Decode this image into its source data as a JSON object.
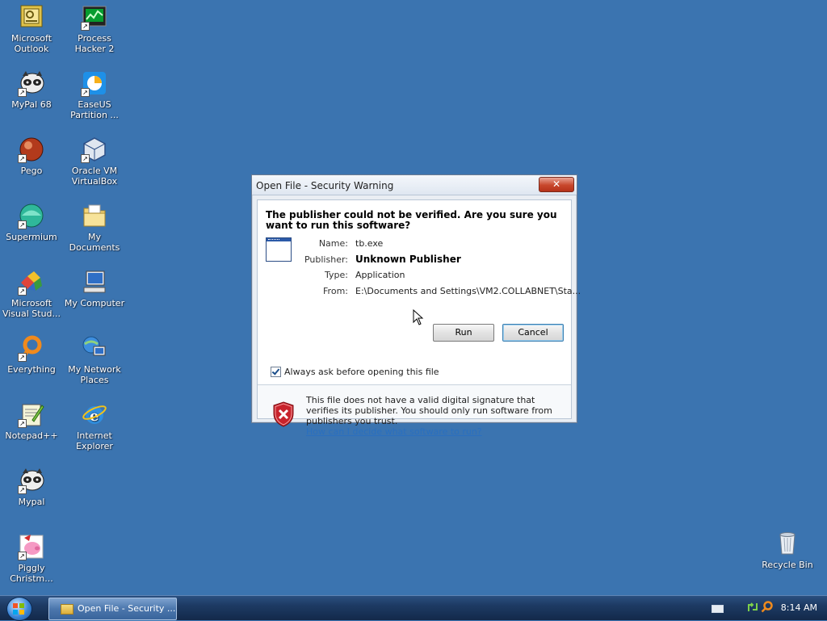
{
  "desktop": {
    "icons": [
      {
        "label": "Microsoft Outlook",
        "icon": "outlook-icon"
      },
      {
        "label": "Process Hacker 2",
        "icon": "process-hacker-icon"
      },
      {
        "label": "MyPal 68",
        "icon": "mypal-icon"
      },
      {
        "label": "EaseUS Partition ...",
        "icon": "easeus-icon"
      },
      {
        "label": "Pego",
        "icon": "pego-icon"
      },
      {
        "label": "Oracle VM VirtualBox",
        "icon": "virtualbox-icon"
      },
      {
        "label": "Supermium",
        "icon": "supermium-icon"
      },
      {
        "label": "My Documents",
        "icon": "folder-icon"
      },
      {
        "label": "Microsoft Visual Stud...",
        "icon": "visual-studio-icon"
      },
      {
        "label": "My Computer",
        "icon": "computer-icon"
      },
      {
        "label": "Everything",
        "icon": "everything-icon"
      },
      {
        "label": "My Network Places",
        "icon": "network-icon"
      },
      {
        "label": "Notepad++",
        "icon": "notepad-plus-plus-icon"
      },
      {
        "label": "Internet Explorer",
        "icon": "internet-explorer-icon"
      },
      {
        "label": "Mypal",
        "icon": "mypal-icon"
      },
      {
        "label": "Piggly Christm...",
        "icon": "piggly-icon"
      },
      {
        "label": "Recycle Bin",
        "icon": "recycle-bin-icon"
      }
    ]
  },
  "dialog": {
    "title": "Open File - Security Warning",
    "close_label": "✕",
    "headline": "The publisher could not be verified.  Are you sure you want to run this software?",
    "fields": [
      {
        "label": "Name:",
        "value": "tb.exe"
      },
      {
        "label": "Publisher:",
        "value": "Unknown Publisher"
      },
      {
        "label": "Type:",
        "value": "Application"
      },
      {
        "label": "From:",
        "value": "E:\\Documents and Settings\\VM2.COLLABNET\\Sta..."
      }
    ],
    "run_label": "Run",
    "cancel_label": "Cancel",
    "checkbox_label": "Always ask before opening this file",
    "checkbox_checked": true,
    "warning_text": "This file does not have a valid digital signature that verifies its publisher.  You should only run software from publishers you trust.",
    "warning_link": "How can I decide what software to run?"
  },
  "taskbar": {
    "task_label": "Open File - Security ...",
    "clock": "8:14 AM"
  },
  "colors": {
    "desktop_bg": "#3b74b0",
    "warning_red": "#c8232c",
    "link_blue": "#2a6fbf"
  }
}
